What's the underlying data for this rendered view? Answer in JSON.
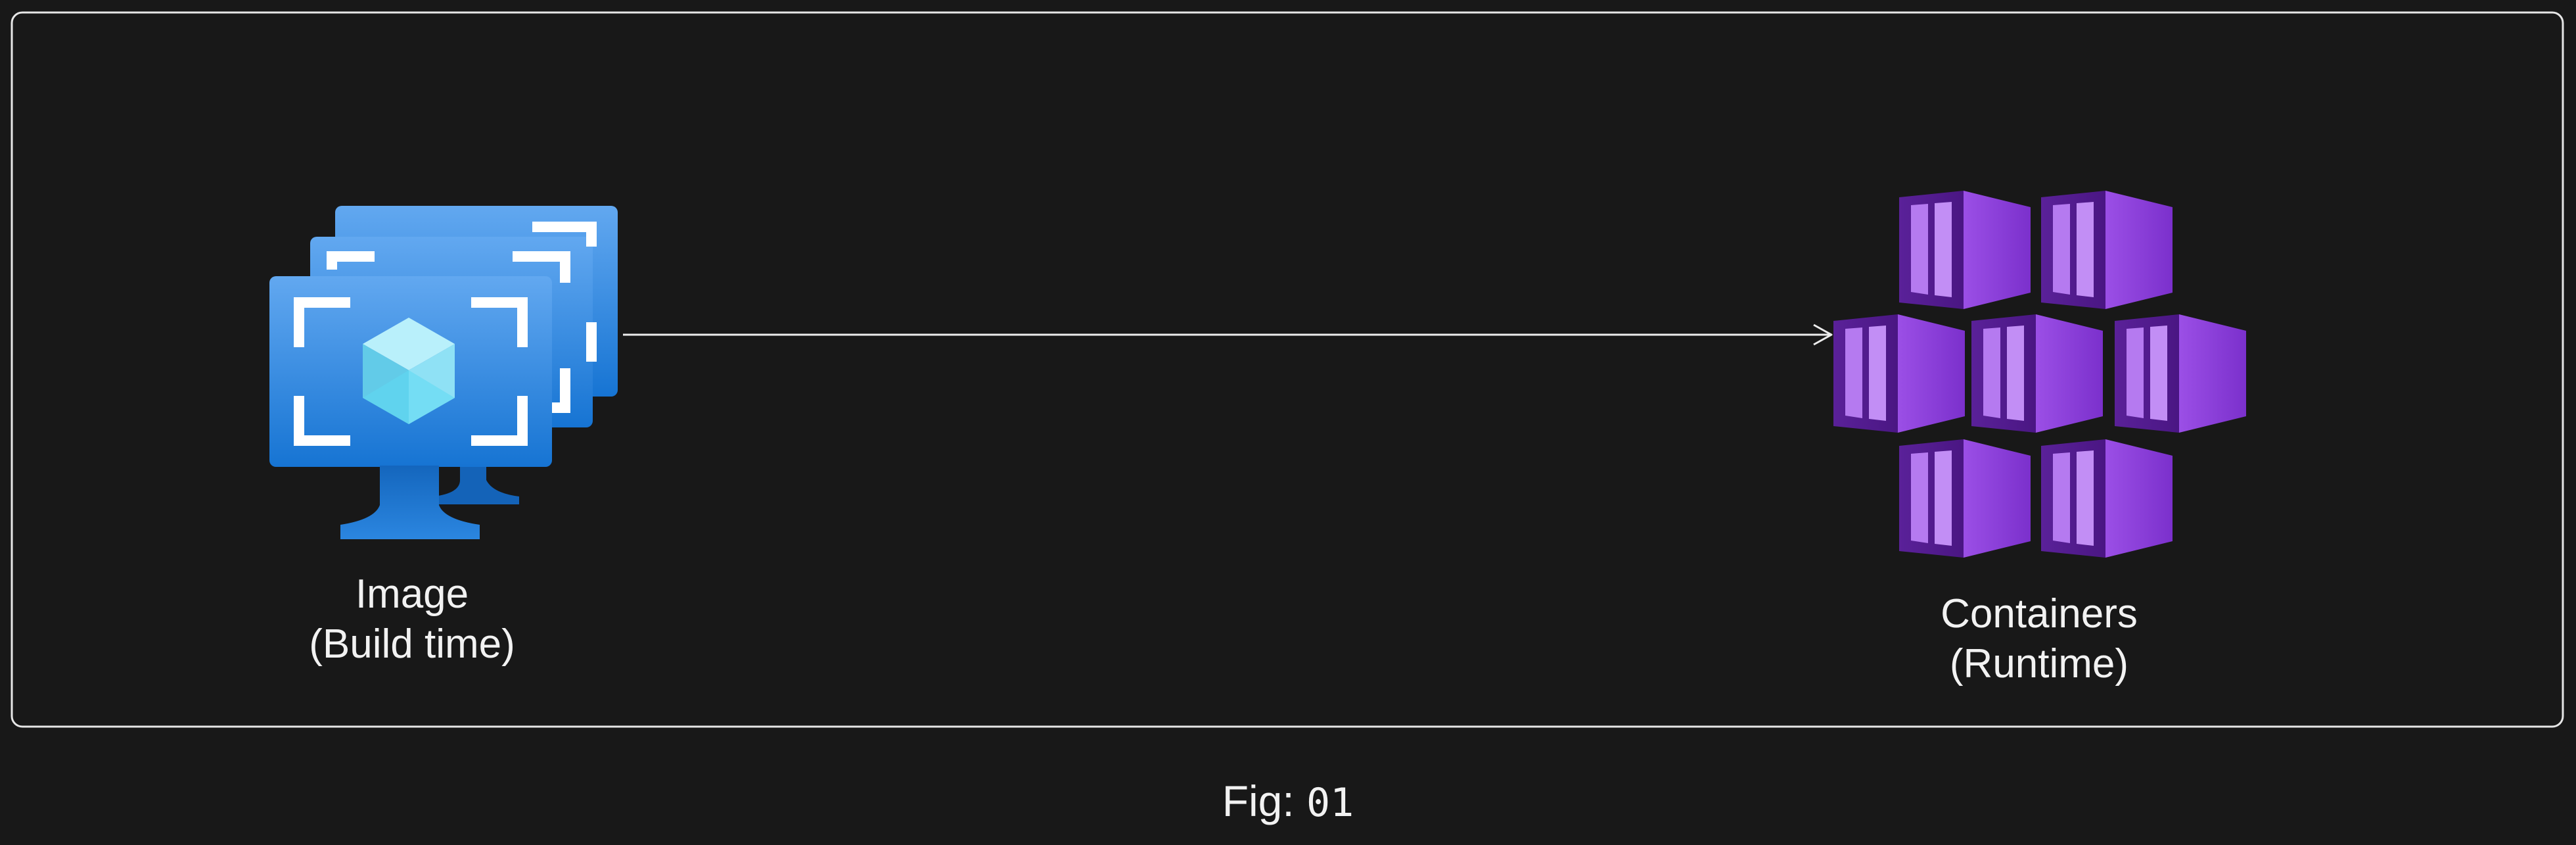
{
  "diagram": {
    "nodes": [
      {
        "id": "image",
        "icon": "vm-image-icon",
        "label_lines": [
          "Image",
          "(Build time)"
        ]
      },
      {
        "id": "containers",
        "icon": "container-cluster-icon",
        "label_lines": [
          "Containers",
          "(Runtime)"
        ]
      }
    ],
    "edges": [
      {
        "from": "image",
        "to": "containers"
      }
    ]
  },
  "caption": {
    "prefix": "Fig: ",
    "number": "01"
  },
  "colors": {
    "background": "#181818",
    "frame": "#e8e8e8",
    "image_blue": "#1a79d6",
    "image_blue_light": "#5ea6ef",
    "cube_cyan": "#7fe3f7",
    "container_purple": "#8e3fd8",
    "container_purple_light": "#b57af0",
    "container_purple_dark": "#4e1a8c"
  }
}
